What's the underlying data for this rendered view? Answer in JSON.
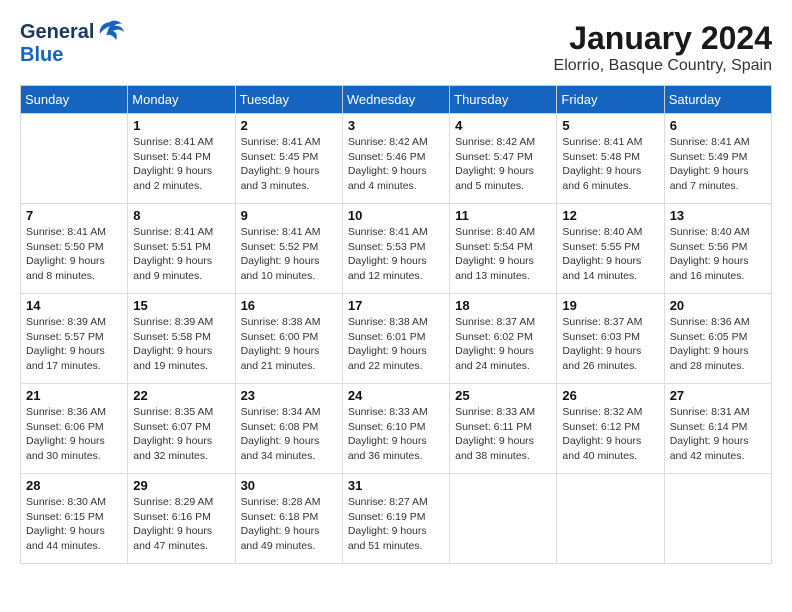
{
  "header": {
    "logo_general": "General",
    "logo_blue": "Blue",
    "month_title": "January 2024",
    "location": "Elorrio, Basque Country, Spain"
  },
  "days_of_week": [
    "Sunday",
    "Monday",
    "Tuesday",
    "Wednesday",
    "Thursday",
    "Friday",
    "Saturday"
  ],
  "weeks": [
    [
      {
        "day": "",
        "info": ""
      },
      {
        "day": "1",
        "info": "Sunrise: 8:41 AM\nSunset: 5:44 PM\nDaylight: 9 hours\nand 2 minutes."
      },
      {
        "day": "2",
        "info": "Sunrise: 8:41 AM\nSunset: 5:45 PM\nDaylight: 9 hours\nand 3 minutes."
      },
      {
        "day": "3",
        "info": "Sunrise: 8:42 AM\nSunset: 5:46 PM\nDaylight: 9 hours\nand 4 minutes."
      },
      {
        "day": "4",
        "info": "Sunrise: 8:42 AM\nSunset: 5:47 PM\nDaylight: 9 hours\nand 5 minutes."
      },
      {
        "day": "5",
        "info": "Sunrise: 8:41 AM\nSunset: 5:48 PM\nDaylight: 9 hours\nand 6 minutes."
      },
      {
        "day": "6",
        "info": "Sunrise: 8:41 AM\nSunset: 5:49 PM\nDaylight: 9 hours\nand 7 minutes."
      }
    ],
    [
      {
        "day": "7",
        "info": "Sunrise: 8:41 AM\nSunset: 5:50 PM\nDaylight: 9 hours\nand 8 minutes."
      },
      {
        "day": "8",
        "info": "Sunrise: 8:41 AM\nSunset: 5:51 PM\nDaylight: 9 hours\nand 9 minutes."
      },
      {
        "day": "9",
        "info": "Sunrise: 8:41 AM\nSunset: 5:52 PM\nDaylight: 9 hours\nand 10 minutes."
      },
      {
        "day": "10",
        "info": "Sunrise: 8:41 AM\nSunset: 5:53 PM\nDaylight: 9 hours\nand 12 minutes."
      },
      {
        "day": "11",
        "info": "Sunrise: 8:40 AM\nSunset: 5:54 PM\nDaylight: 9 hours\nand 13 minutes."
      },
      {
        "day": "12",
        "info": "Sunrise: 8:40 AM\nSunset: 5:55 PM\nDaylight: 9 hours\nand 14 minutes."
      },
      {
        "day": "13",
        "info": "Sunrise: 8:40 AM\nSunset: 5:56 PM\nDaylight: 9 hours\nand 16 minutes."
      }
    ],
    [
      {
        "day": "14",
        "info": "Sunrise: 8:39 AM\nSunset: 5:57 PM\nDaylight: 9 hours\nand 17 minutes."
      },
      {
        "day": "15",
        "info": "Sunrise: 8:39 AM\nSunset: 5:58 PM\nDaylight: 9 hours\nand 19 minutes."
      },
      {
        "day": "16",
        "info": "Sunrise: 8:38 AM\nSunset: 6:00 PM\nDaylight: 9 hours\nand 21 minutes."
      },
      {
        "day": "17",
        "info": "Sunrise: 8:38 AM\nSunset: 6:01 PM\nDaylight: 9 hours\nand 22 minutes."
      },
      {
        "day": "18",
        "info": "Sunrise: 8:37 AM\nSunset: 6:02 PM\nDaylight: 9 hours\nand 24 minutes."
      },
      {
        "day": "19",
        "info": "Sunrise: 8:37 AM\nSunset: 6:03 PM\nDaylight: 9 hours\nand 26 minutes."
      },
      {
        "day": "20",
        "info": "Sunrise: 8:36 AM\nSunset: 6:05 PM\nDaylight: 9 hours\nand 28 minutes."
      }
    ],
    [
      {
        "day": "21",
        "info": "Sunrise: 8:36 AM\nSunset: 6:06 PM\nDaylight: 9 hours\nand 30 minutes."
      },
      {
        "day": "22",
        "info": "Sunrise: 8:35 AM\nSunset: 6:07 PM\nDaylight: 9 hours\nand 32 minutes."
      },
      {
        "day": "23",
        "info": "Sunrise: 8:34 AM\nSunset: 6:08 PM\nDaylight: 9 hours\nand 34 minutes."
      },
      {
        "day": "24",
        "info": "Sunrise: 8:33 AM\nSunset: 6:10 PM\nDaylight: 9 hours\nand 36 minutes."
      },
      {
        "day": "25",
        "info": "Sunrise: 8:33 AM\nSunset: 6:11 PM\nDaylight: 9 hours\nand 38 minutes."
      },
      {
        "day": "26",
        "info": "Sunrise: 8:32 AM\nSunset: 6:12 PM\nDaylight: 9 hours\nand 40 minutes."
      },
      {
        "day": "27",
        "info": "Sunrise: 8:31 AM\nSunset: 6:14 PM\nDaylight: 9 hours\nand 42 minutes."
      }
    ],
    [
      {
        "day": "28",
        "info": "Sunrise: 8:30 AM\nSunset: 6:15 PM\nDaylight: 9 hours\nand 44 minutes."
      },
      {
        "day": "29",
        "info": "Sunrise: 8:29 AM\nSunset: 6:16 PM\nDaylight: 9 hours\nand 47 minutes."
      },
      {
        "day": "30",
        "info": "Sunrise: 8:28 AM\nSunset: 6:18 PM\nDaylight: 9 hours\nand 49 minutes."
      },
      {
        "day": "31",
        "info": "Sunrise: 8:27 AM\nSunset: 6:19 PM\nDaylight: 9 hours\nand 51 minutes."
      },
      {
        "day": "",
        "info": ""
      },
      {
        "day": "",
        "info": ""
      },
      {
        "day": "",
        "info": ""
      }
    ]
  ]
}
